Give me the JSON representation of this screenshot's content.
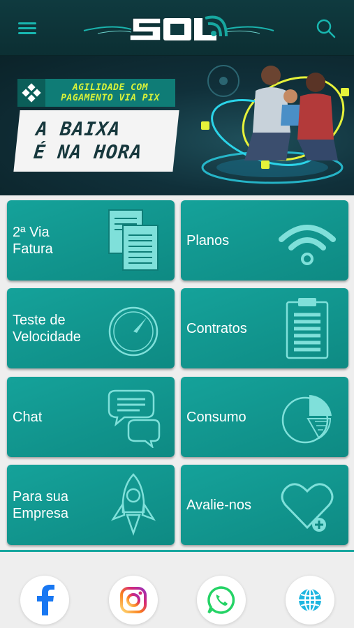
{
  "header": {
    "logo_text": "SOL",
    "menu_icon": "hamburger-menu-icon",
    "search_icon": "search-icon"
  },
  "banner": {
    "tag_line1": "AGILIDADE COM",
    "tag_line2": "PAGAMENTO VIA PIX",
    "headline_line1": "A BAIXA",
    "headline_line2": "É NA HORA"
  },
  "tiles": [
    {
      "label": "2ª Via\nFatura",
      "icon": "invoice-document-icon"
    },
    {
      "label": "Planos",
      "icon": "wifi-icon"
    },
    {
      "label": "Teste de\nVelocidade",
      "icon": "speedometer-icon"
    },
    {
      "label": "Contratos",
      "icon": "clipboard-icon"
    },
    {
      "label": "Chat",
      "icon": "chat-bubbles-icon"
    },
    {
      "label": "Consumo",
      "icon": "pie-chart-icon"
    },
    {
      "label": "Para sua\nEmpresa",
      "icon": "rocket-icon"
    },
    {
      "label": "Avalie-nos",
      "icon": "heart-plus-icon"
    }
  ],
  "social": [
    {
      "name": "facebook",
      "icon": "facebook-icon",
      "color": "#1877f2"
    },
    {
      "name": "instagram",
      "icon": "instagram-icon",
      "color": "#e1306c"
    },
    {
      "name": "whatsapp",
      "icon": "whatsapp-icon",
      "color": "#25d366"
    },
    {
      "name": "website",
      "icon": "globe-icon",
      "color": "#1fb6e0"
    }
  ],
  "colors": {
    "header_bg": "#0f3a3f",
    "accent": "#17a79f",
    "tile_bg": "#12998f",
    "tag_text": "#d8f23a"
  }
}
